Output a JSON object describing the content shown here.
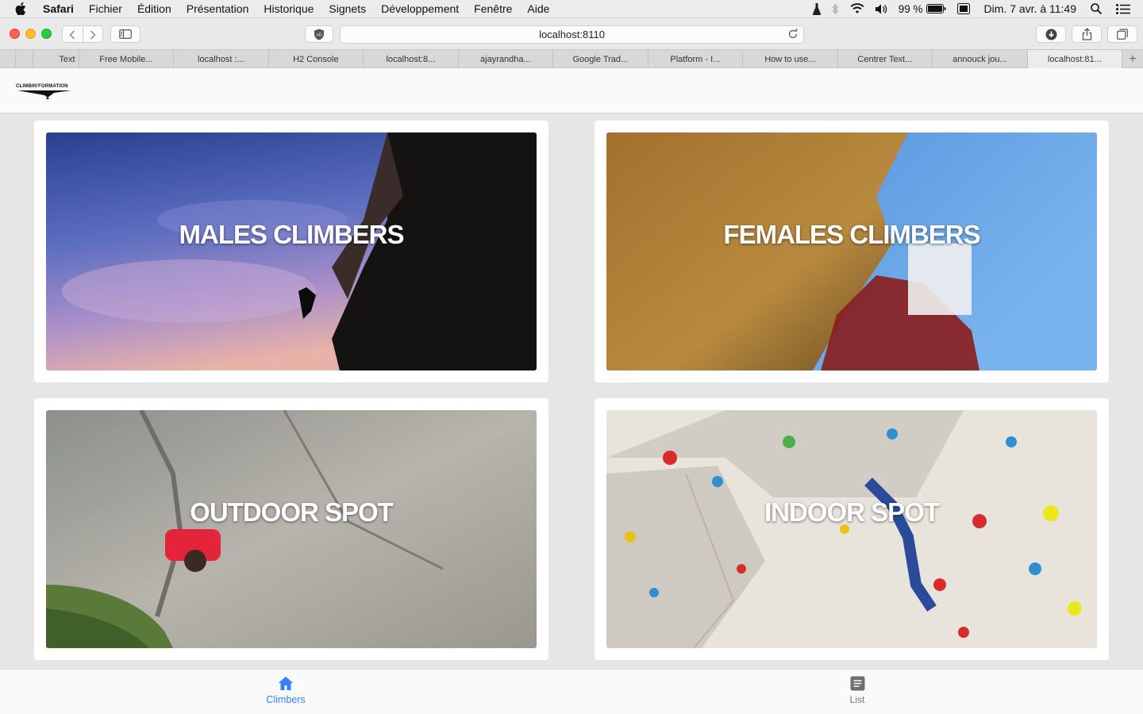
{
  "menubar": {
    "app": "Safari",
    "items": [
      "Fichier",
      "Édition",
      "Présentation",
      "Historique",
      "Signets",
      "Développement",
      "Fenêtre",
      "Aide"
    ],
    "battery": "99 %",
    "clock": "Dim. 7 avr. à  11:49"
  },
  "browser": {
    "url": "localhost:8110",
    "tabs": [
      "Text",
      "Free Mobile...",
      "localhost :...",
      "H2 Console",
      "localhost:8...",
      "ajayrandha...",
      "Google Trad...",
      "Platform - I...",
      "How to use...",
      "Centrer Text...",
      "annouck jou...",
      "localhost:81..."
    ],
    "add_tab": "+"
  },
  "app": {
    "logo_text": "CLIMBIN'FORMATION",
    "cards": [
      {
        "title": "MALES CLIMBERS"
      },
      {
        "title": "FEMALES CLIMBERS"
      },
      {
        "title": "OUTDOOR SPOT"
      },
      {
        "title": "INDOOR SPOT"
      }
    ],
    "bottom_tabs": [
      {
        "label": "Climbers",
        "icon": "home-icon",
        "active": true
      },
      {
        "label": "List",
        "icon": "list-icon",
        "active": false
      }
    ],
    "colors": {
      "accent": "#3880ff",
      "inactive": "#777777"
    }
  }
}
